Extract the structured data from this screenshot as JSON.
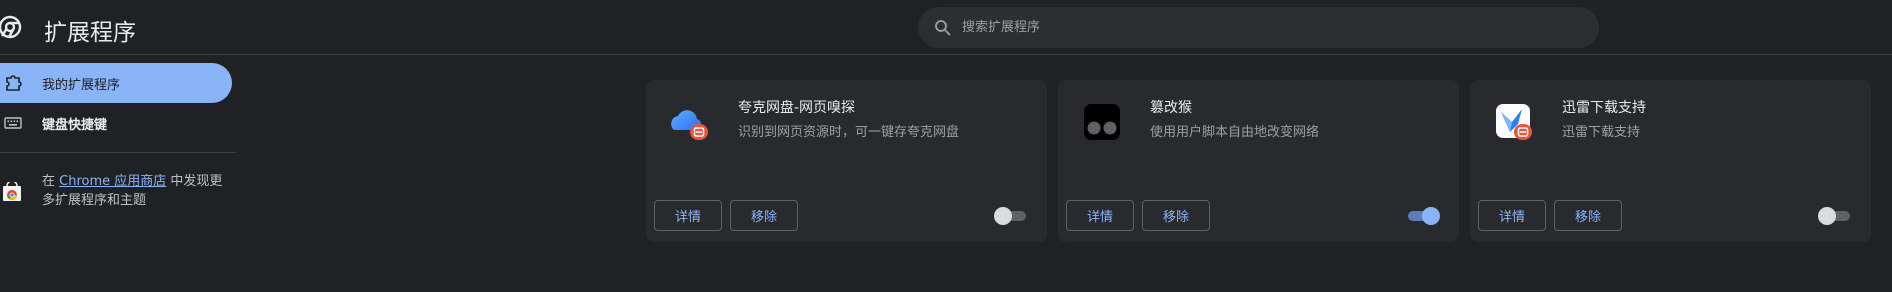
{
  "header": {
    "title": "扩展程序",
    "search_placeholder": "搜索扩展程序"
  },
  "sidebar": {
    "items": [
      {
        "label": "我的扩展程序",
        "icon": "extension-puzzle-icon",
        "active": true
      },
      {
        "label": "键盘快捷键",
        "icon": "keyboard-icon",
        "active": false
      }
    ],
    "webstore": {
      "prefix": "在 ",
      "link": "Chrome 应用商店",
      "suffix": " 中发现更多扩展程序和主题",
      "icon": "chrome-webstore-icon"
    }
  },
  "extensions": [
    {
      "name": "夸克网盘-网页嗅探",
      "description": "识别到网页资源时，可一键存夸克网盘",
      "icon": "quark-cloud-icon",
      "details_label": "详情",
      "remove_label": "移除",
      "enabled": false
    },
    {
      "name": "篡改猴",
      "description": "使用用户脚本自由地改变网络",
      "icon": "tampermonkey-icon",
      "details_label": "详情",
      "remove_label": "移除",
      "enabled": true
    },
    {
      "name": "迅雷下载支持",
      "description": "迅雷下载支持",
      "icon": "thunder-bird-icon",
      "details_label": "详情",
      "remove_label": "移除",
      "enabled": false
    }
  ],
  "colors": {
    "background": "#202124",
    "card": "#292a2d",
    "accent": "#8ab4f8",
    "badge": "#e8553a"
  }
}
